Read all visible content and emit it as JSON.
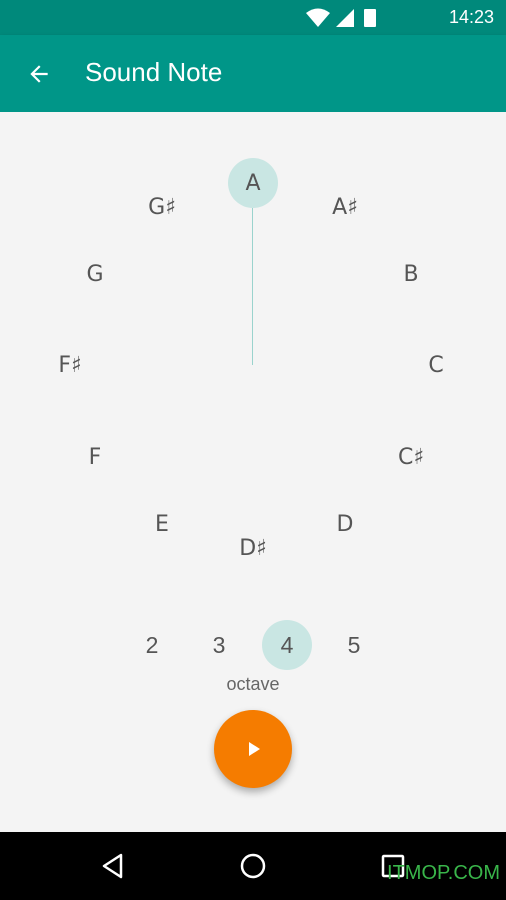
{
  "status_bar": {
    "time": "14:23"
  },
  "app_bar": {
    "title": "Sound Note"
  },
  "notes": {
    "A": "A",
    "A_sharp": "A♯",
    "B": "B",
    "C": "C",
    "C_sharp": "C♯",
    "D": "D",
    "D_sharp": "D♯",
    "E": "E",
    "F": "F",
    "F_sharp": "F♯",
    "G": "G",
    "G_sharp": "G♯",
    "selected": "A"
  },
  "octave": {
    "options": [
      "2",
      "3",
      "4",
      "5"
    ],
    "selected": "4",
    "label": "octave"
  },
  "watermark": "ITMOP.COM",
  "colors": {
    "primary": "#009688",
    "primary_dark": "#00897b",
    "accent": "#f57c00",
    "selected_bg": "#c9e6e3"
  }
}
